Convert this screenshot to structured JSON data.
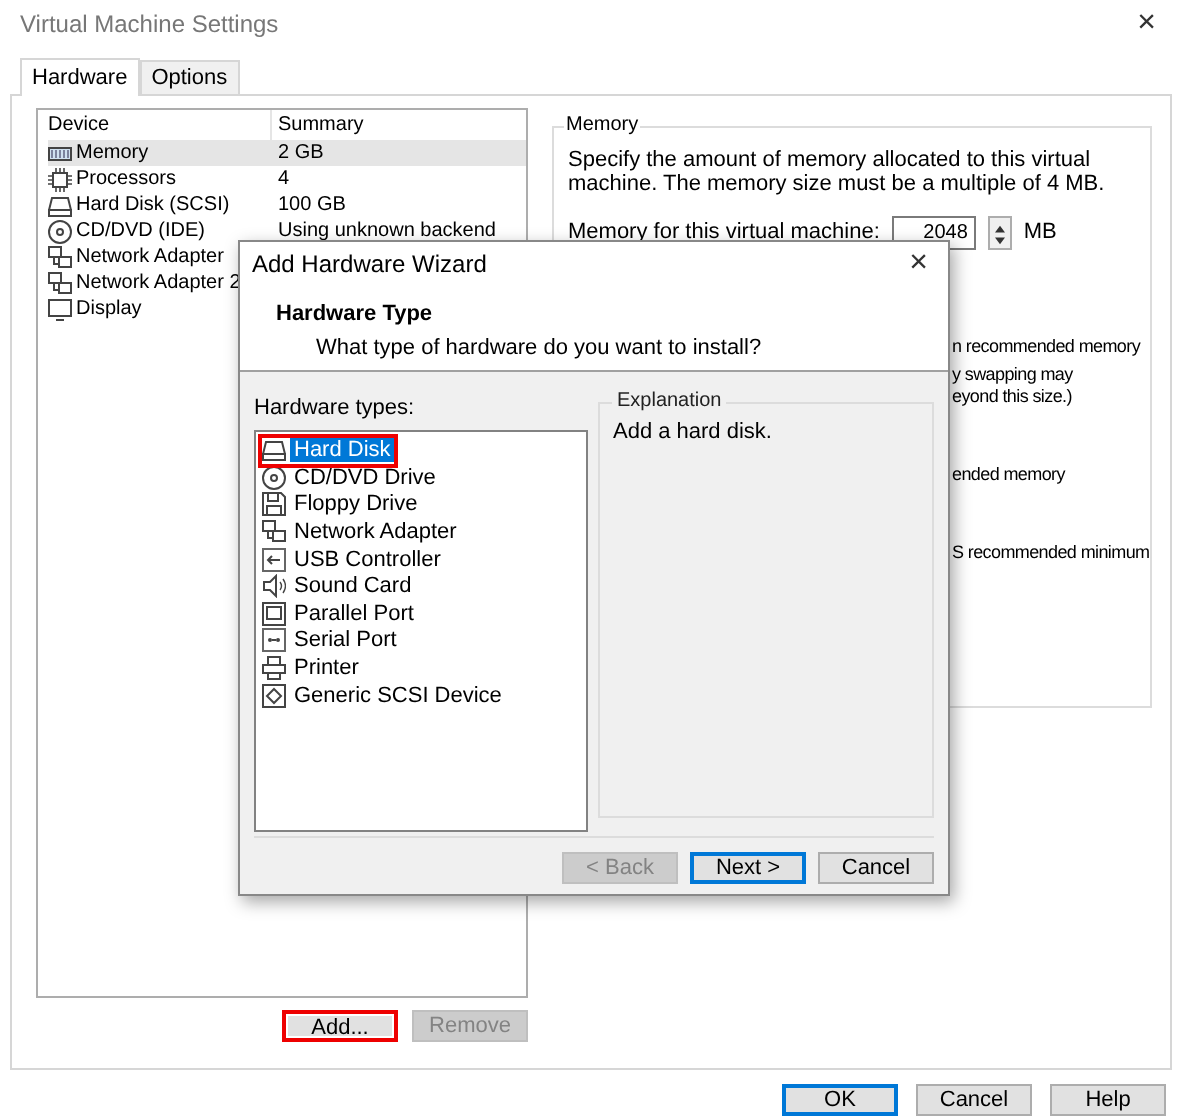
{
  "window": {
    "title": "Virtual Machine Settings",
    "close": "×"
  },
  "tabs": [
    {
      "label": "Hardware",
      "selected": true
    },
    {
      "label": "Options",
      "selected": false
    }
  ],
  "device_table": {
    "columns": [
      "Device",
      "Summary"
    ],
    "rows": [
      {
        "kind": "memory",
        "device": "Memory",
        "summary": "2 GB",
        "selected": true
      },
      {
        "kind": "cpu",
        "device": "Processors",
        "summary": "4",
        "selected": false
      },
      {
        "kind": "disk",
        "device": "Hard Disk (SCSI)",
        "summary": "100 GB",
        "selected": false
      },
      {
        "kind": "cd",
        "device": "CD/DVD (IDE)",
        "summary": "Using unknown backend",
        "selected": false
      },
      {
        "kind": "network",
        "device": "Network Adapter",
        "selected": false
      },
      {
        "kind": "network",
        "device": "Network Adapter 2",
        "selected": false
      },
      {
        "kind": "display",
        "device": "Display",
        "selected": false
      }
    ]
  },
  "device_buttons": [
    {
      "label": "Add...",
      "disabled": false,
      "highlighted": true
    },
    {
      "label": "Remove",
      "disabled": true,
      "highlighted": false
    }
  ],
  "memory": {
    "title": "Memory",
    "description": "Specify the amount of memory allocated to this virtual machine. The memory size must be a multiple of 4 MB.",
    "field_label": "Memory for this virtual machine:",
    "value": "2048",
    "unit": "MB",
    "fragments": [
      "n recommended memory",
      "y swapping may",
      "eyond this size.)",
      "ended memory",
      "S recommended minimum"
    ]
  },
  "dialog_buttons": [
    {
      "label": "OK",
      "default": true
    },
    {
      "label": "Cancel",
      "default": false
    },
    {
      "label": "Help",
      "default": false
    }
  ],
  "wizard": {
    "title": "Add Hardware Wizard",
    "close": "×",
    "heading": "Hardware Type",
    "subheading": "What type of hardware do you want to install?",
    "list_label": "Hardware types:",
    "items": [
      {
        "kind": "disk",
        "label": "Hard Disk",
        "selected": true,
        "highlighted": true
      },
      {
        "kind": "cd",
        "label": "CD/DVD Drive",
        "selected": false,
        "highlighted": false
      },
      {
        "kind": "floppy",
        "label": "Floppy Drive",
        "selected": false,
        "highlighted": false
      },
      {
        "kind": "network",
        "label": "Network Adapter",
        "selected": false,
        "highlighted": false
      },
      {
        "kind": "usb",
        "label": "USB Controller",
        "selected": false,
        "highlighted": false
      },
      {
        "kind": "sound",
        "label": "Sound Card",
        "selected": false,
        "highlighted": false
      },
      {
        "kind": "parallel",
        "label": "Parallel Port",
        "selected": false,
        "highlighted": false
      },
      {
        "kind": "serial",
        "label": "Serial Port",
        "selected": false,
        "highlighted": false
      },
      {
        "kind": "printer",
        "label": "Printer",
        "selected": false,
        "highlighted": false
      },
      {
        "kind": "scsi",
        "label": "Generic SCSI Device",
        "selected": false,
        "highlighted": false
      }
    ],
    "explanation_title": "Explanation",
    "explanation": "Add a hard disk.",
    "buttons": [
      {
        "label": "< Back",
        "disabled": true,
        "default": false
      },
      {
        "label": "Next >",
        "disabled": false,
        "default": true
      },
      {
        "label": "Cancel",
        "disabled": false,
        "default": false
      }
    ]
  }
}
